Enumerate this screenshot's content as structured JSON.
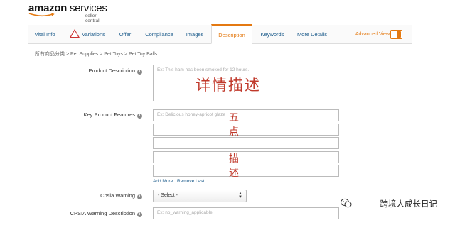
{
  "brand": {
    "logo_main": "amazon",
    "logo_services": "services",
    "subtitle": "seller central"
  },
  "tabs": [
    {
      "label": "Vital Info"
    },
    {
      "label": "Variations",
      "icon": "warning-icon"
    },
    {
      "label": "Offer"
    },
    {
      "label": "Compliance"
    },
    {
      "label": "Images"
    },
    {
      "label": "Description",
      "active": true
    },
    {
      "label": "Keywords"
    },
    {
      "label": "More Details"
    }
  ],
  "advanced_view": "Advanced View",
  "breadcrumb": "所有商品分类 > Pet Supplies > Pet Toys > Pet Toy Balls",
  "product_description": {
    "label": "Product Description",
    "placeholder": "Ex: This ham has been smoked for 12 hours.",
    "overlay": "详情描述"
  },
  "key_features": {
    "label": "Key Product Features",
    "placeholder": "Ex: Delicious honey-apricot glaze",
    "overlays": [
      "五",
      "点",
      "",
      "描",
      "述"
    ]
  },
  "links": {
    "add_more": "Add More",
    "remove_last": "Remove Last"
  },
  "cpsia": {
    "label": "Cpsia Warning",
    "selected": "- Select -"
  },
  "cpsia_desc": {
    "label": "CPSIA Warning Description",
    "placeholder": "Ex: no_warning_applicable"
  },
  "watermark": "跨境人成长日记",
  "colors": {
    "accent": "#e47911",
    "link": "#1a5a8a",
    "overlay_red": "#c0392b"
  }
}
